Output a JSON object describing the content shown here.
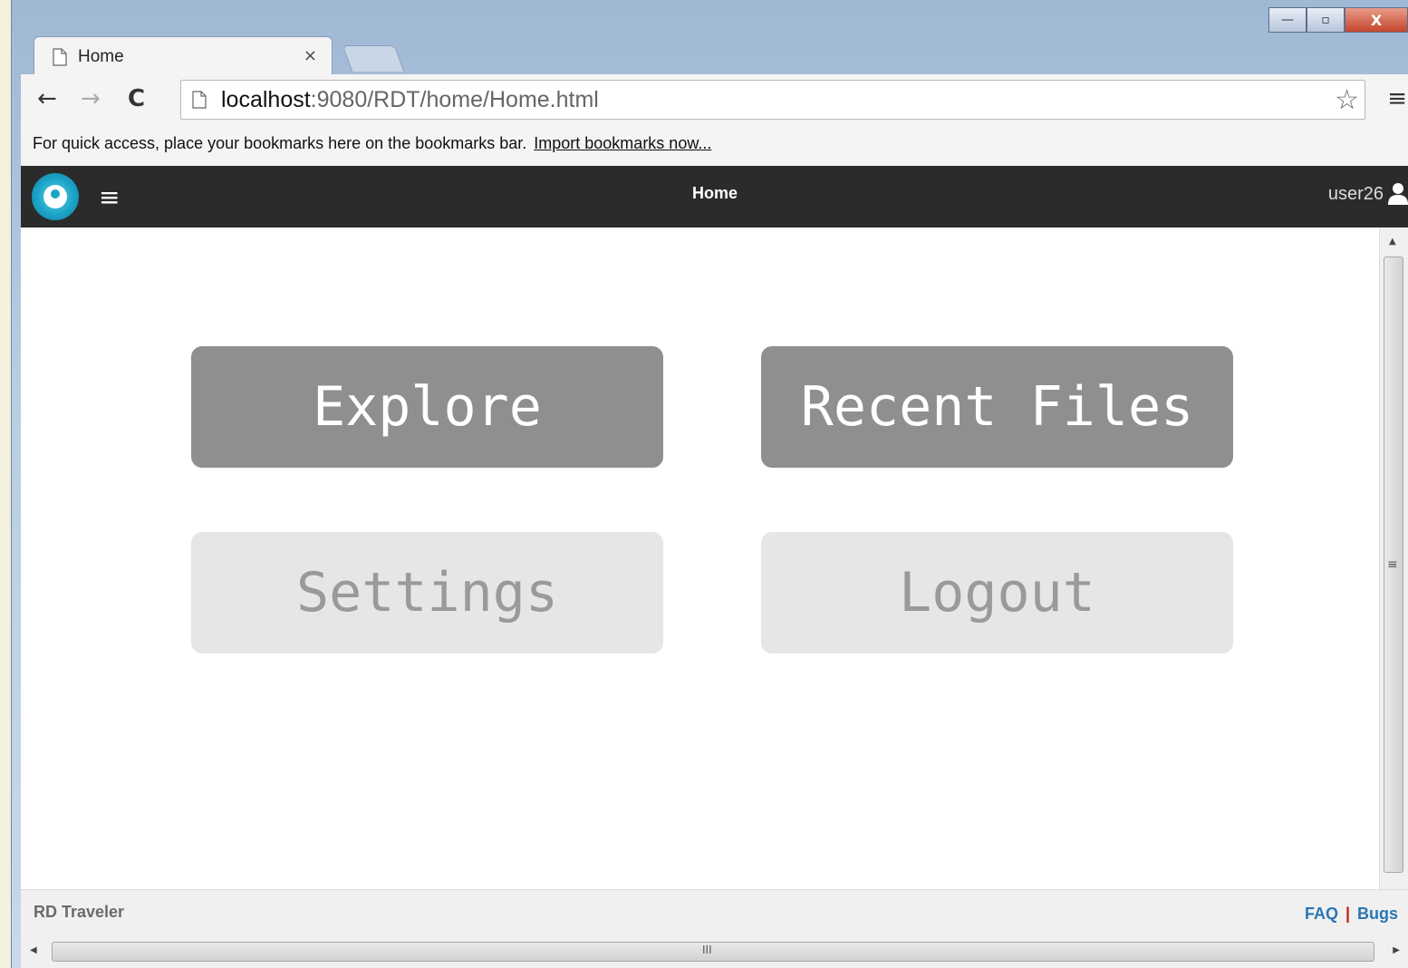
{
  "browser": {
    "tab_title": "Home",
    "tab_close": "×",
    "url_host": "localhost",
    "url_rest": ":9080/RDT/home/Home.html",
    "bookmarks_text": "For quick access, place your bookmarks here on the bookmarks bar.",
    "bookmarks_link": "Import bookmarks now..."
  },
  "window_controls": {
    "minimize": "—",
    "restore": "▫",
    "close": "X"
  },
  "app": {
    "title": "Home",
    "user": "user26",
    "accent": "#1ba4c7",
    "bar_color": "#2b2b2b"
  },
  "tiles": [
    {
      "label": "Explore",
      "style": "dark"
    },
    {
      "label": "Recent Files",
      "style": "dark"
    },
    {
      "label": "Settings",
      "style": "light"
    },
    {
      "label": "Logout",
      "style": "light"
    }
  ],
  "footer": {
    "brand": "RD Traveler",
    "faq": "FAQ",
    "separator": "|",
    "bugs": "Bugs",
    "link_color": "#2a76b2"
  },
  "icons": [
    "page-icon",
    "back-arrow-icon",
    "forward-arrow-icon",
    "reload-icon",
    "star-icon",
    "menu-icon",
    "app-logo-icon",
    "hamburger-icon",
    "user-icon"
  ]
}
